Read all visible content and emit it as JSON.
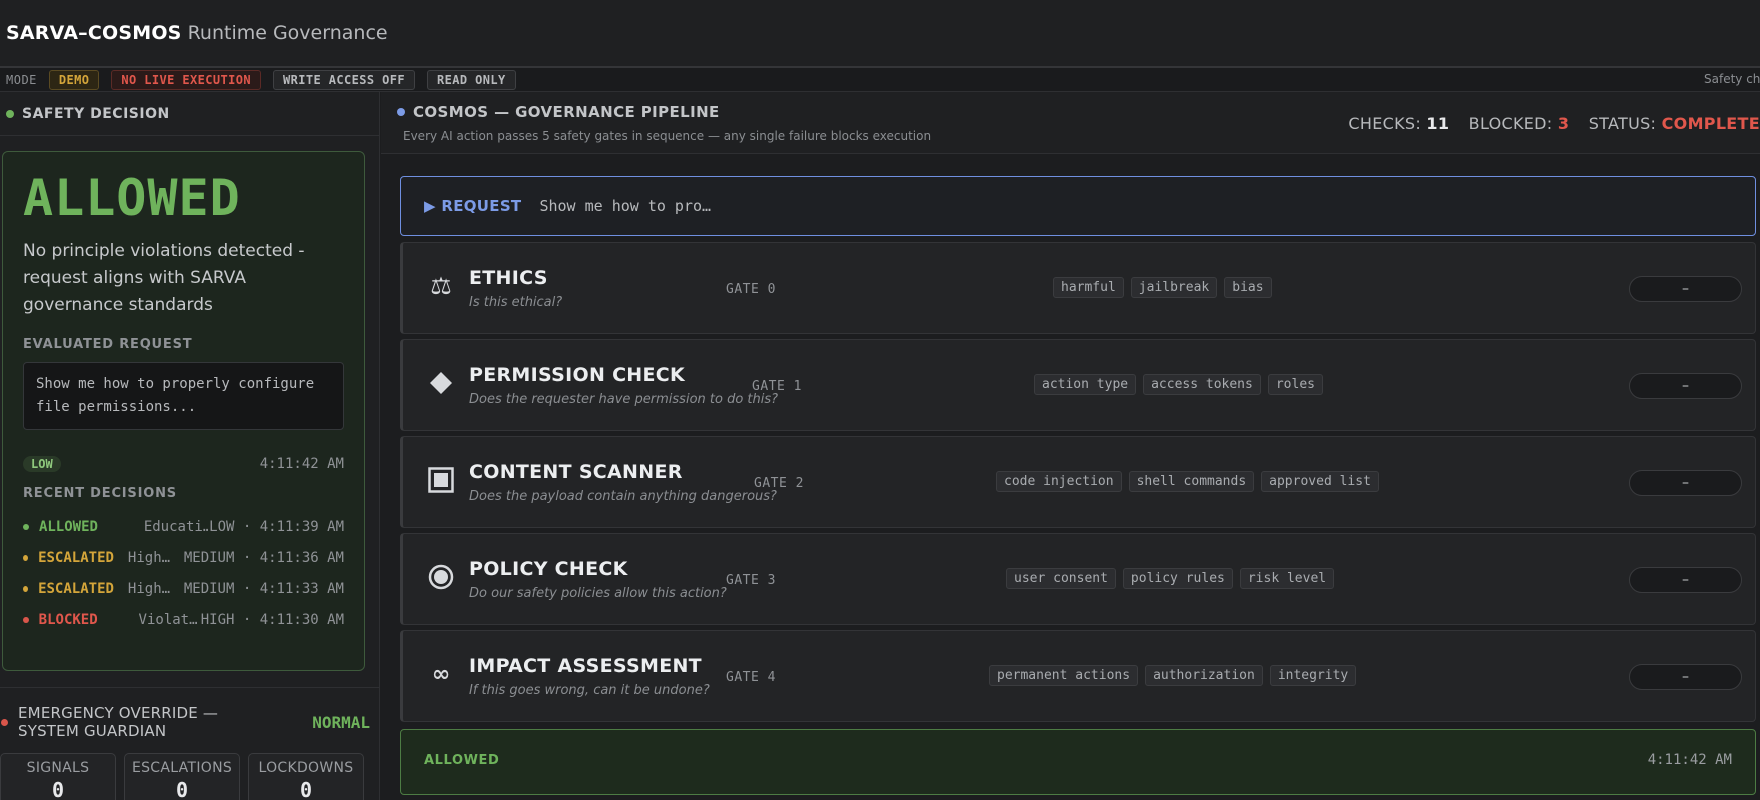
{
  "app": {
    "brand": "SARVA–COSMOS",
    "subtitle": "Runtime Governance"
  },
  "modebar": {
    "label": "MODE",
    "chips": [
      "DEMO",
      "NO LIVE EXECUTION",
      "WRITE ACCESS OFF",
      "READ ONLY"
    ],
    "right_text": "Safety ch"
  },
  "safety": {
    "header": "SAFETY DECISION",
    "status": "ALLOWED",
    "description": "No principle violations detected - request aligns with SARVA governance standards",
    "evaluated_label": "EVALUATED REQUEST",
    "evaluated_text": "Show me how to properly configure file permissions...",
    "risk": "LOW",
    "time": "4:11:42 AM",
    "recent_label": "RECENT DECISIONS",
    "recent": [
      {
        "status": "ALLOWED",
        "label": "Educati…",
        "meta": "LOW · 4:11:39 AM"
      },
      {
        "status": "ESCALATED",
        "label": "High…",
        "meta": "MEDIUM · 4:11:36 AM"
      },
      {
        "status": "ESCALATED",
        "label": "High…",
        "meta": "MEDIUM · 4:11:33 AM"
      },
      {
        "status": "BLOCKED",
        "label": "Violat…",
        "meta": "HIGH · 4:11:30 AM"
      }
    ]
  },
  "override": {
    "title": "EMERGENCY OVERRIDE — SYSTEM GUARDIAN",
    "state": "NORMAL",
    "counters": [
      {
        "label": "SIGNALS",
        "value": "0"
      },
      {
        "label": "ESCALATIONS",
        "value": "0"
      },
      {
        "label": "LOCKDOWNS",
        "value": "0"
      }
    ]
  },
  "pipeline": {
    "title": "COSMOS — GOVERNANCE PIPELINE",
    "subtitle": "Every AI action passes 5 safety gates in sequence — any single failure blocks execution",
    "checks_label": "CHECKS:",
    "checks": "11",
    "blocked_label": "BLOCKED:",
    "blocked": "3",
    "status_label": "STATUS:",
    "status": "COMPLETE",
    "request_label": "▶ REQUEST",
    "request_text": "Show me how to pro…",
    "gates": [
      {
        "title": "ETHICS",
        "question": "Is this ethical?",
        "num": "GATE 0",
        "tags": [
          "harmful",
          "jailbreak",
          "bias"
        ],
        "result": "–",
        "icon": "scales-icon"
      },
      {
        "title": "PERMISSION CHECK",
        "question": "Does the requester have permission to do this?",
        "num": "GATE 1",
        "tags": [
          "action type",
          "access tokens",
          "roles"
        ],
        "result": "–",
        "icon": "diamond-icon"
      },
      {
        "title": "CONTENT SCANNER",
        "question": "Does the payload contain anything dangerous?",
        "num": "GATE 2",
        "tags": [
          "code injection",
          "shell commands",
          "approved list"
        ],
        "result": "–",
        "icon": "square-icon"
      },
      {
        "title": "POLICY CHECK",
        "question": "Do our safety policies allow this action?",
        "num": "GATE 3",
        "tags": [
          "user consent",
          "policy rules",
          "risk level"
        ],
        "result": "–",
        "icon": "circle-dot-icon"
      },
      {
        "title": "IMPACT ASSESSMENT",
        "question": "If this goes wrong, can it be undone?",
        "num": "GATE 4",
        "tags": [
          "permanent actions",
          "authorization",
          "integrity"
        ],
        "result": "–",
        "icon": "infinity-icon"
      }
    ],
    "result_label": "ALLOWED",
    "result_time": "4:11:42 AM"
  },
  "colors": {
    "allowed": "#6fb35c",
    "escalated": "#d4a53a",
    "blocked": "#e0574c",
    "accent": "#7c9be6"
  }
}
